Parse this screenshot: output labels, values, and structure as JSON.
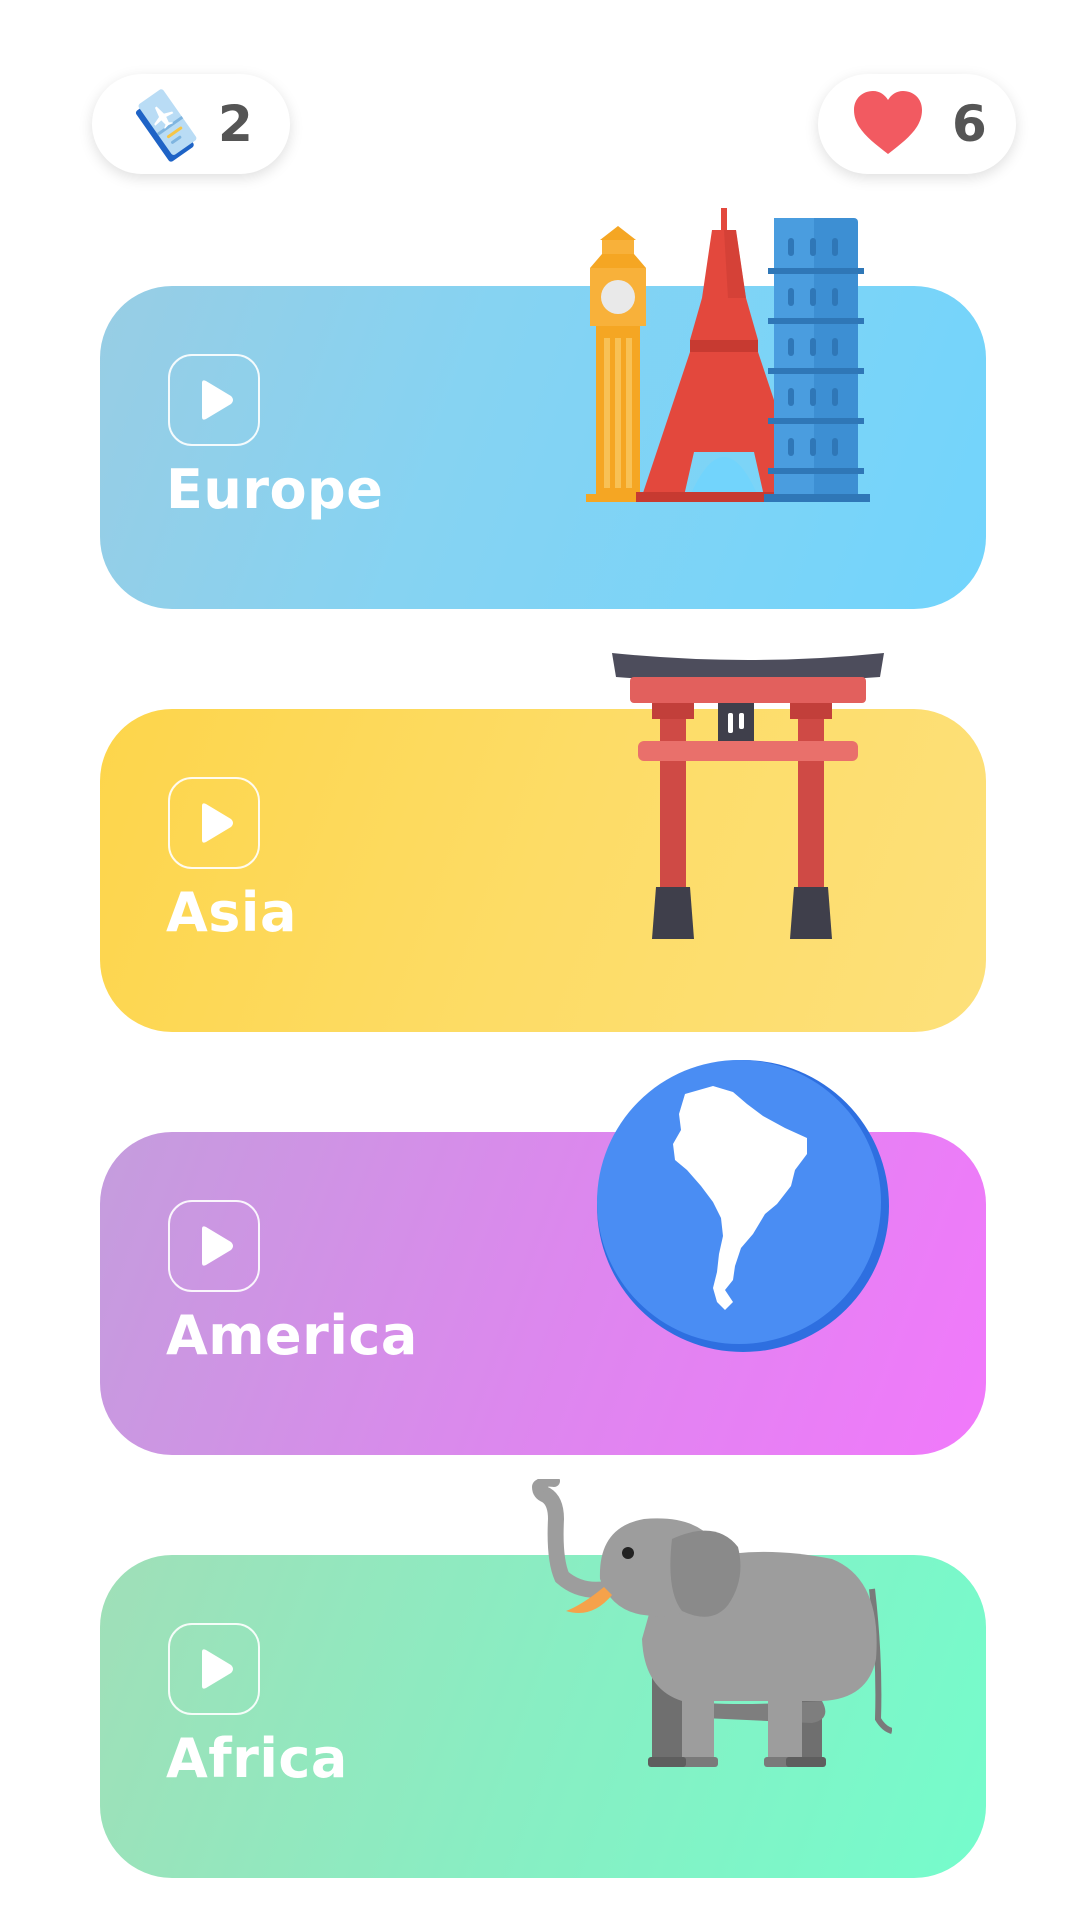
{
  "header": {
    "tickets": {
      "icon": "plane-ticket-icon",
      "count": "2"
    },
    "lives": {
      "icon": "heart-icon",
      "count": "6",
      "color": "#f25a61"
    }
  },
  "continents": [
    {
      "name": "Europe",
      "illustration": "landmarks-icon",
      "colors": [
        "#98cde4",
        "#72d4fc"
      ]
    },
    {
      "name": "Asia",
      "illustration": "torii-gate-icon",
      "colors": [
        "#fdd54b",
        "#fde07a"
      ]
    },
    {
      "name": "America",
      "illustration": "south-america-globe-icon",
      "colors": [
        "#c49ddd",
        "#f179fb"
      ]
    },
    {
      "name": "Africa",
      "illustration": "elephant-icon",
      "colors": [
        "#a0dfb8",
        "#75fccc"
      ]
    }
  ]
}
